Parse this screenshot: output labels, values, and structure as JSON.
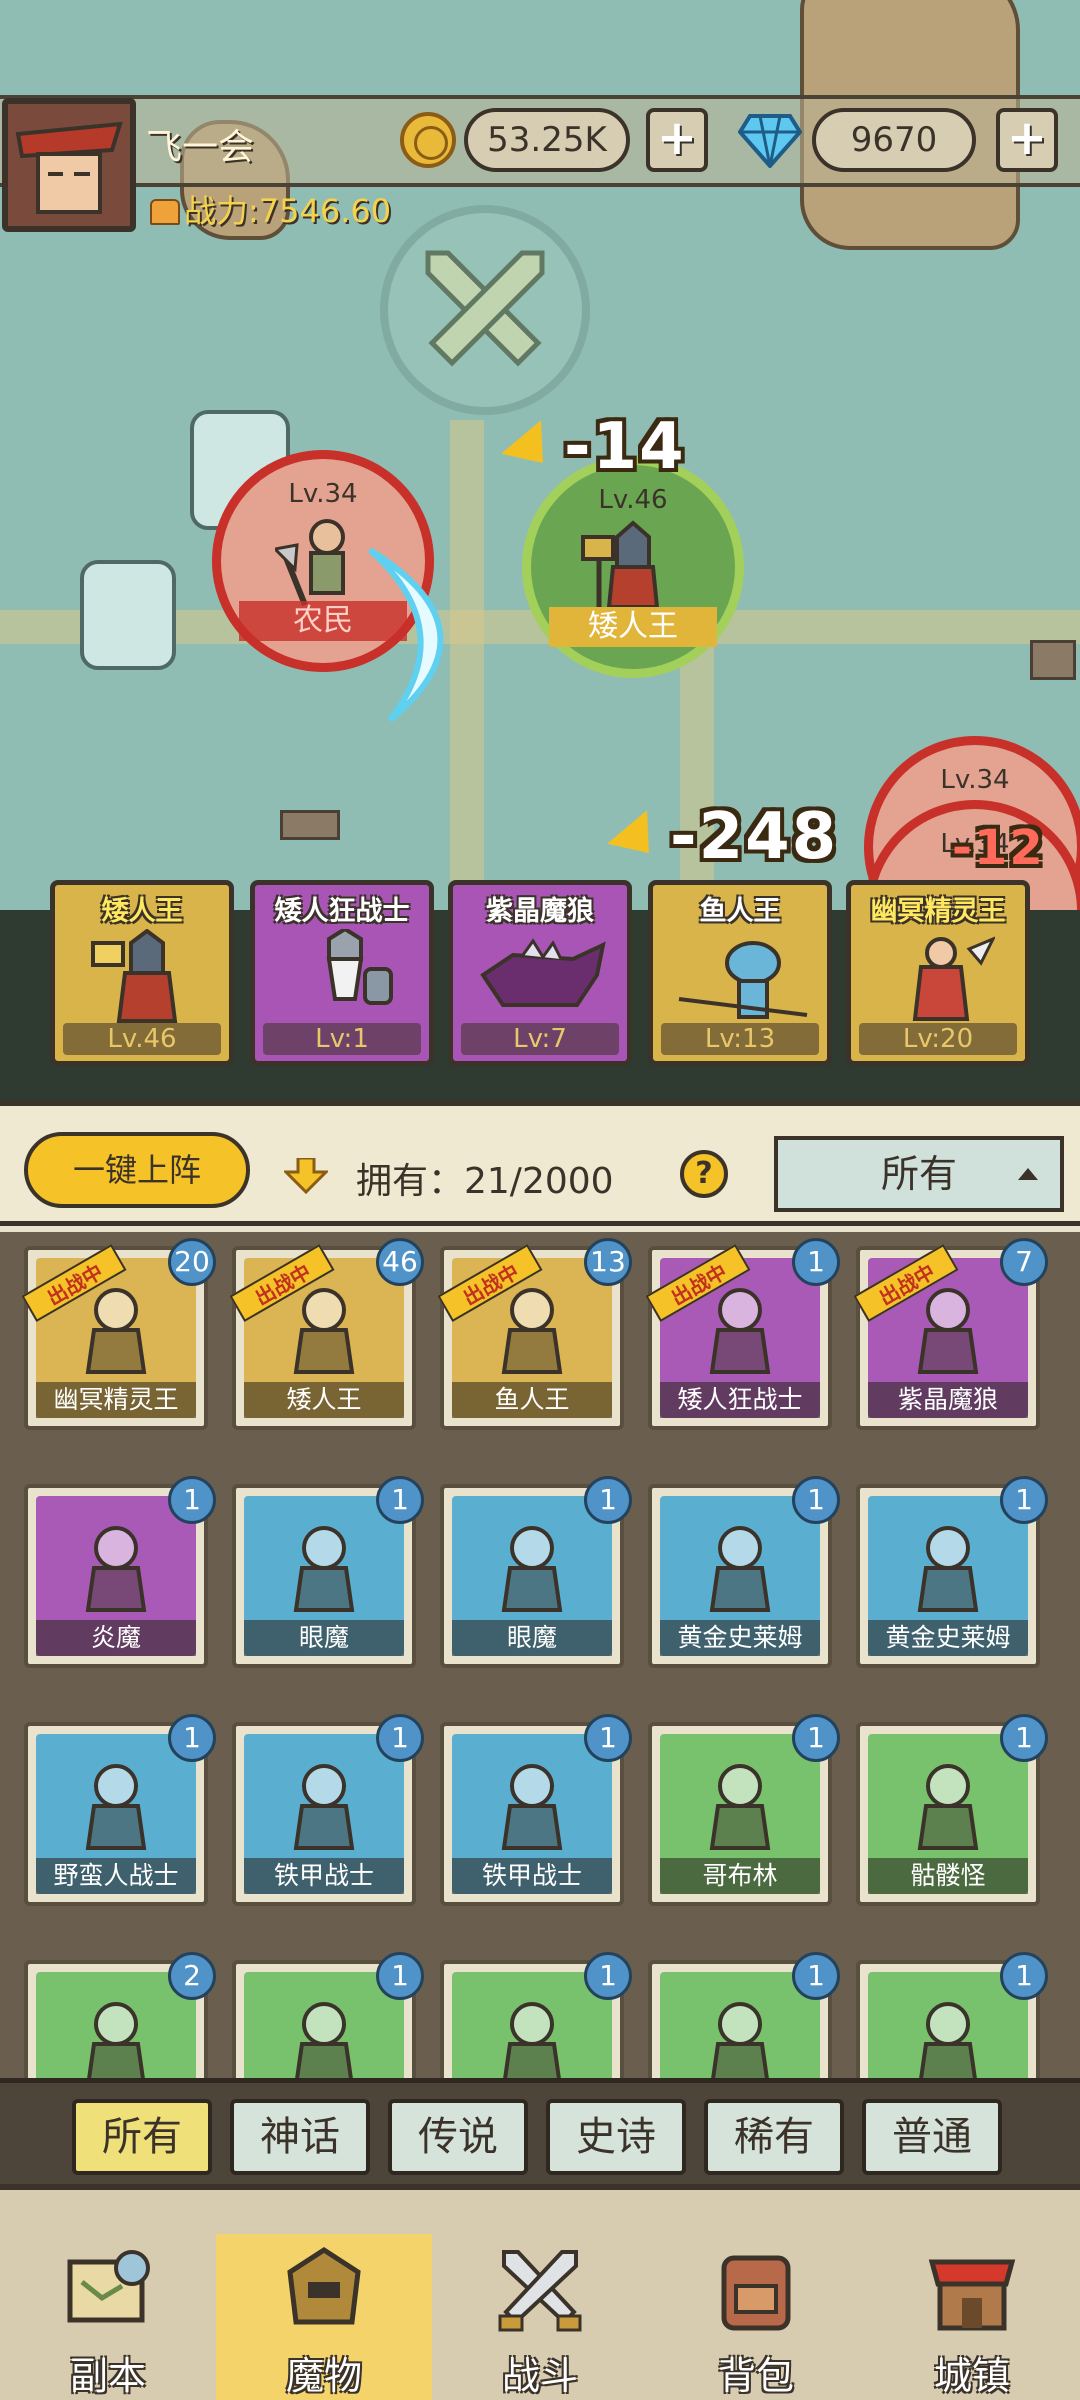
{
  "player": {
    "name": "飞一会",
    "power": "战力:7546.60",
    "gold": "53.25K",
    "gems": "9670",
    "plus": "+"
  },
  "battle": {
    "units": [
      {
        "level": "Lv.34",
        "name": "农民",
        "side": "enemy"
      },
      {
        "level": "Lv.46",
        "name": "矮人王",
        "side": "ally"
      },
      {
        "level": "Lv.34",
        "name": "",
        "side": "enemy"
      },
      {
        "level": "Lv.34",
        "name": "",
        "side": "enemy"
      }
    ],
    "damage": [
      "-14",
      "-248",
      "-12"
    ]
  },
  "squad": [
    {
      "name": "矮人王",
      "level": "Lv.46",
      "rarity": "gold"
    },
    {
      "name": "矮人狂战士",
      "level": "Lv:1",
      "rarity": "purple"
    },
    {
      "name": "紫晶魔狼",
      "level": "Lv:7",
      "rarity": "purple"
    },
    {
      "name": "鱼人王",
      "level": "Lv:13",
      "rarity": "gold"
    },
    {
      "name": "幽冥精灵王",
      "level": "Lv:20",
      "rarity": "gold"
    }
  ],
  "toolbar": {
    "deploy_label": "一键上阵",
    "owned": "拥有：21/2000",
    "help": "?",
    "filter": "所有"
  },
  "deployed_tag": "出战中",
  "monsters": [
    {
      "name": "幽冥精灵王",
      "count": "20",
      "bg": "gold",
      "deployed": true
    },
    {
      "name": "矮人王",
      "count": "46",
      "bg": "gold",
      "deployed": true
    },
    {
      "name": "鱼人王",
      "count": "13",
      "bg": "gold",
      "deployed": true
    },
    {
      "name": "矮人狂战士",
      "count": "1",
      "bg": "purple",
      "deployed": true
    },
    {
      "name": "紫晶魔狼",
      "count": "7",
      "bg": "purple",
      "deployed": true
    },
    {
      "name": "炎魔",
      "count": "1",
      "bg": "purple",
      "deployed": false
    },
    {
      "name": "眼魔",
      "count": "1",
      "bg": "blue",
      "deployed": false
    },
    {
      "name": "眼魔",
      "count": "1",
      "bg": "blue",
      "deployed": false
    },
    {
      "name": "黄金史莱姆",
      "count": "1",
      "bg": "blue",
      "deployed": false
    },
    {
      "name": "黄金史莱姆",
      "count": "1",
      "bg": "blue",
      "deployed": false
    },
    {
      "name": "野蛮人战士",
      "count": "1",
      "bg": "blue",
      "deployed": false
    },
    {
      "name": "铁甲战士",
      "count": "1",
      "bg": "blue",
      "deployed": false
    },
    {
      "name": "铁甲战士",
      "count": "1",
      "bg": "blue",
      "deployed": false
    },
    {
      "name": "哥布林",
      "count": "1",
      "bg": "green",
      "deployed": false
    },
    {
      "name": "骷髅怪",
      "count": "1",
      "bg": "green",
      "deployed": false
    },
    {
      "name": "",
      "count": "2",
      "bg": "green",
      "deployed": false
    },
    {
      "name": "",
      "count": "1",
      "bg": "green",
      "deployed": false
    },
    {
      "name": "",
      "count": "1",
      "bg": "green",
      "deployed": false
    },
    {
      "name": "",
      "count": "1",
      "bg": "green",
      "deployed": false
    },
    {
      "name": "",
      "count": "1",
      "bg": "green",
      "deployed": false
    }
  ],
  "rarity_tabs": [
    "所有",
    "神话",
    "传说",
    "史诗",
    "稀有",
    "普通"
  ],
  "nav": [
    {
      "label": "副本",
      "icon": "map-scroll-icon"
    },
    {
      "label": "魔物",
      "icon": "monster-helmet-icon",
      "active": true
    },
    {
      "label": "战斗",
      "icon": "crossed-swords-icon"
    },
    {
      "label": "背包",
      "icon": "backpack-icon"
    },
    {
      "label": "城镇",
      "icon": "town-shop-icon"
    }
  ],
  "colors": {
    "gold": "#dbb453",
    "purple": "#a95ab6",
    "blue": "#5aaed0",
    "green": "#79c26d",
    "accent": "#f5c227",
    "outline": "#3b332a"
  }
}
